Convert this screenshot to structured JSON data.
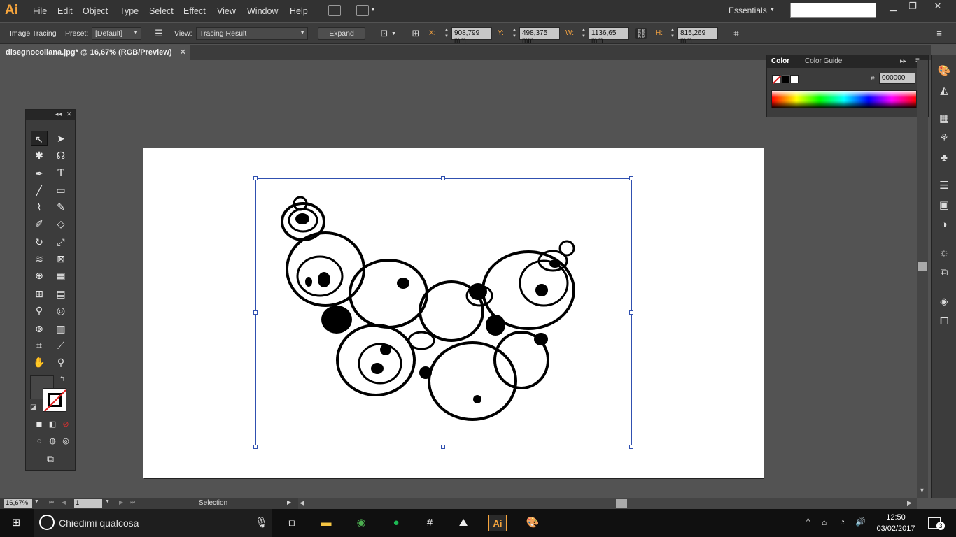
{
  "app": {
    "logo": "Ai"
  },
  "menu": [
    "File",
    "Edit",
    "Object",
    "Type",
    "Select",
    "Effect",
    "View",
    "Window",
    "Help"
  ],
  "workspace": {
    "label": "Essentials"
  },
  "control_bar": {
    "panel_label": "Image Tracing",
    "preset_label": "Preset:",
    "preset_value": "[Default]",
    "view_label": "View:",
    "view_value": "Tracing Result",
    "expand_label": "Expand",
    "x_label": "X:",
    "x_value": "908,799 mm",
    "y_label": "Y:",
    "y_value": "498,375 mm",
    "w_label": "W:",
    "w_value": "1136,65 mm",
    "h_label": "H:",
    "h_value": "815,269 mm"
  },
  "document": {
    "tab_title": "disegnocollana.jpg* @ 16,67% (RGB/Preview)"
  },
  "color_panel": {
    "tabs": [
      "Color",
      "Color Guide"
    ],
    "hex_label": "#",
    "hex_value": "000000"
  },
  "status": {
    "zoom": "16,67%",
    "artboard": "1",
    "tool": "Selection"
  },
  "taskbar": {
    "search_placeholder": "Chiedimi qualcosa",
    "time": "12:50",
    "date": "03/02/2017",
    "notifications": "3"
  },
  "colors": {
    "accent": "#f7a53c",
    "selection": "#3050b0"
  }
}
